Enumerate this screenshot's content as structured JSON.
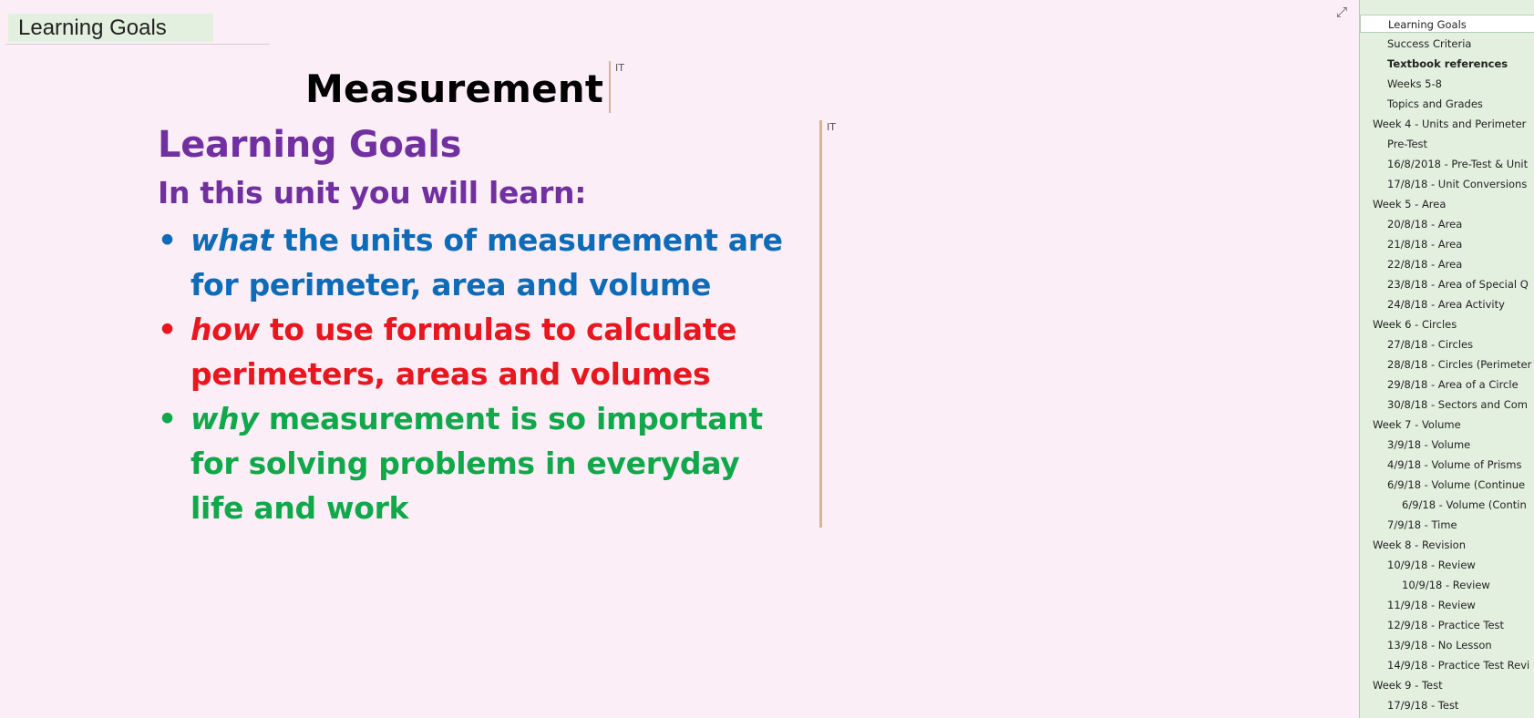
{
  "page": {
    "title": "Learning Goals"
  },
  "toolbar": {
    "expand_icon": "⤢"
  },
  "outline_heading": {
    "text": "Measurement",
    "tag": "IT"
  },
  "outline_goals": {
    "tag": "IT",
    "heading": "Learning Goals",
    "subheading": "In this unit you will learn:",
    "bullets": [
      {
        "italic": "what",
        "rest": " the units of measurement are for perimeter, area and volume",
        "color": "#0E6BB8"
      },
      {
        "italic": "how",
        "rest": " to use formulas to calculate perimeters, areas and volumes",
        "color": "#E8161E"
      },
      {
        "italic": "why",
        "rest": " measurement is so important for solving problems in everyday life and work",
        "color": "#10A84A"
      }
    ],
    "heading_color": "#7030A0"
  },
  "sidebar": {
    "items": [
      {
        "label": "Learning Goals",
        "level": 1,
        "selected": true,
        "bold": false
      },
      {
        "label": "Success Criteria",
        "level": 1
      },
      {
        "label": "Textbook references",
        "level": 1,
        "bold": true
      },
      {
        "label": "Weeks 5-8",
        "level": 1
      },
      {
        "label": "Topics and Grades",
        "level": 1
      },
      {
        "label": "Week 4 - Units and Perimeter",
        "level": 0
      },
      {
        "label": "Pre-Test",
        "level": 1
      },
      {
        "label": "16/8/2018 - Pre-Test & Unit",
        "level": 1
      },
      {
        "label": "17/8/18 - Unit Conversions",
        "level": 1
      },
      {
        "label": "Week 5 - Area",
        "level": 0
      },
      {
        "label": "20/8/18 - Area",
        "level": 1
      },
      {
        "label": "21/8/18 - Area",
        "level": 1
      },
      {
        "label": "22/8/18 - Area",
        "level": 1
      },
      {
        "label": "23/8/18 - Area of Special Q",
        "level": 1
      },
      {
        "label": "24/8/18 - Area Activity",
        "level": 1
      },
      {
        "label": "Week 6 - Circles",
        "level": 0
      },
      {
        "label": "27/8/18 - Circles",
        "level": 1
      },
      {
        "label": "28/8/18 - Circles (Perimeter",
        "level": 1
      },
      {
        "label": "29/8/18 - Area of a Circle",
        "level": 1
      },
      {
        "label": "30/8/18 - Sectors and Com",
        "level": 1
      },
      {
        "label": "Week 7 - Volume",
        "level": 0
      },
      {
        "label": "3/9/18 - Volume",
        "level": 1
      },
      {
        "label": "4/9/18 - Volume of Prisms",
        "level": 1
      },
      {
        "label": "6/9/18 - Volume (Continue",
        "level": 1
      },
      {
        "label": "6/9/18 - Volume (Contin",
        "level": 2
      },
      {
        "label": "7/9/18 - Time",
        "level": 1
      },
      {
        "label": "Week 8 - Revision",
        "level": 0
      },
      {
        "label": "10/9/18 - Review",
        "level": 1
      },
      {
        "label": "10/9/18 - Review",
        "level": 2
      },
      {
        "label": "11/9/18 - Review",
        "level": 1
      },
      {
        "label": "12/9/18 - Practice Test",
        "level": 1
      },
      {
        "label": "13/9/18 - No Lesson",
        "level": 1
      },
      {
        "label": "14/9/18 - Practice Test Revi",
        "level": 1
      },
      {
        "label": "Week 9 - Test",
        "level": 0
      },
      {
        "label": "17/9/18 - Test",
        "level": 1
      }
    ]
  }
}
